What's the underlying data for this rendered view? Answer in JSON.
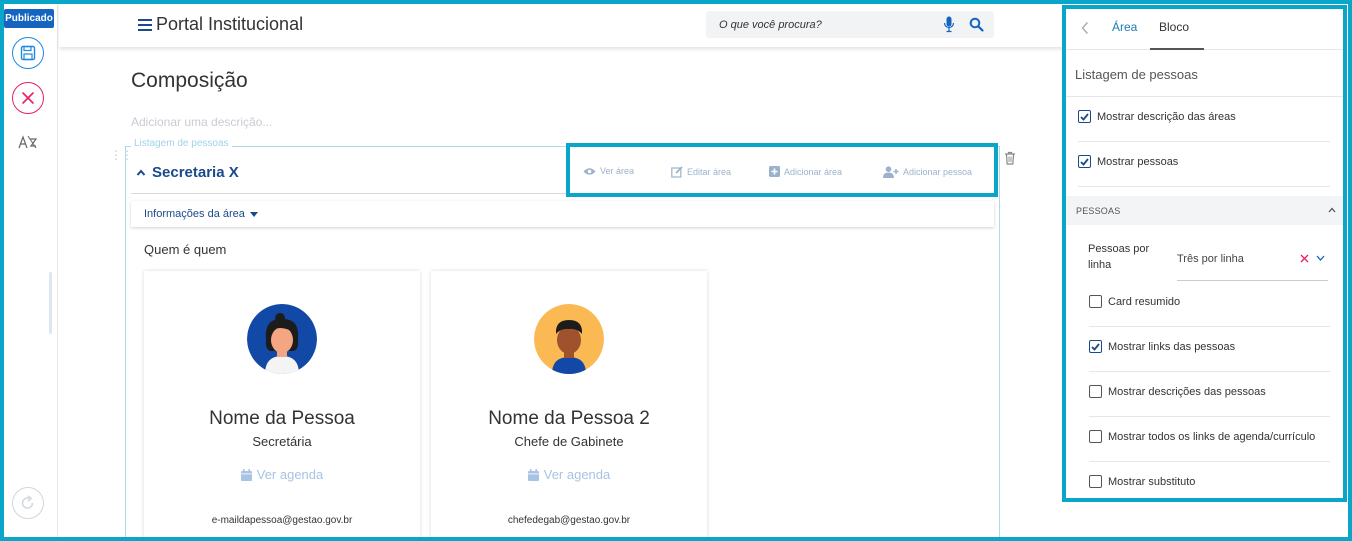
{
  "left_toolbar": {
    "status_badge": "Publicado"
  },
  "header": {
    "title": "Portal Institucional",
    "search_placeholder": "O que você procura?"
  },
  "main": {
    "page_title": "Composição",
    "description_placeholder": "Adicionar uma descrição...",
    "block_label": "Listagem de pessoas",
    "section_title": "Secretaria X",
    "actions": {
      "view": "Ver área",
      "edit": "Editar área",
      "add_area": "Adicionar área",
      "add_person": "Adicionar pessoa"
    },
    "area_info_label": "Informações da área",
    "who_label": "Quem é quem",
    "people": [
      {
        "name": "Nome da Pessoa",
        "role": "Secretária",
        "agenda_label": "Ver agenda",
        "email": "e-maildapessoa@gestao.gov.br"
      },
      {
        "name": "Nome da Pessoa 2",
        "role": "Chefe de Gabinete",
        "agenda_label": "Ver agenda",
        "email": "chefedegab@gestao.gov.br"
      }
    ]
  },
  "sidebar": {
    "tabs": [
      "Área",
      "Bloco"
    ],
    "active_tab": "Bloco",
    "block_title": "Listagem de pessoas",
    "options": [
      {
        "label": "Mostrar descrição das áreas",
        "checked": true
      },
      {
        "label": "Mostrar pessoas",
        "checked": true
      }
    ],
    "people_section": {
      "title": "PESSOAS",
      "per_row_label": "Pessoas por linha",
      "per_row_value": "Três por linha",
      "options": [
        {
          "label": "Card resumido",
          "checked": false
        },
        {
          "label": "Mostrar links das pessoas",
          "checked": true
        },
        {
          "label": "Mostrar descrições das pessoas",
          "checked": false
        },
        {
          "label": "Mostrar todos os links de agenda/currículo",
          "checked": false
        },
        {
          "label": "Mostrar substituto",
          "checked": false
        }
      ]
    }
  },
  "colors": {
    "accent": "#0aa6c9",
    "brand_blue": "#1a4a8a",
    "badge_blue": "#1565c0",
    "cancel_pink": "#e91e63"
  }
}
